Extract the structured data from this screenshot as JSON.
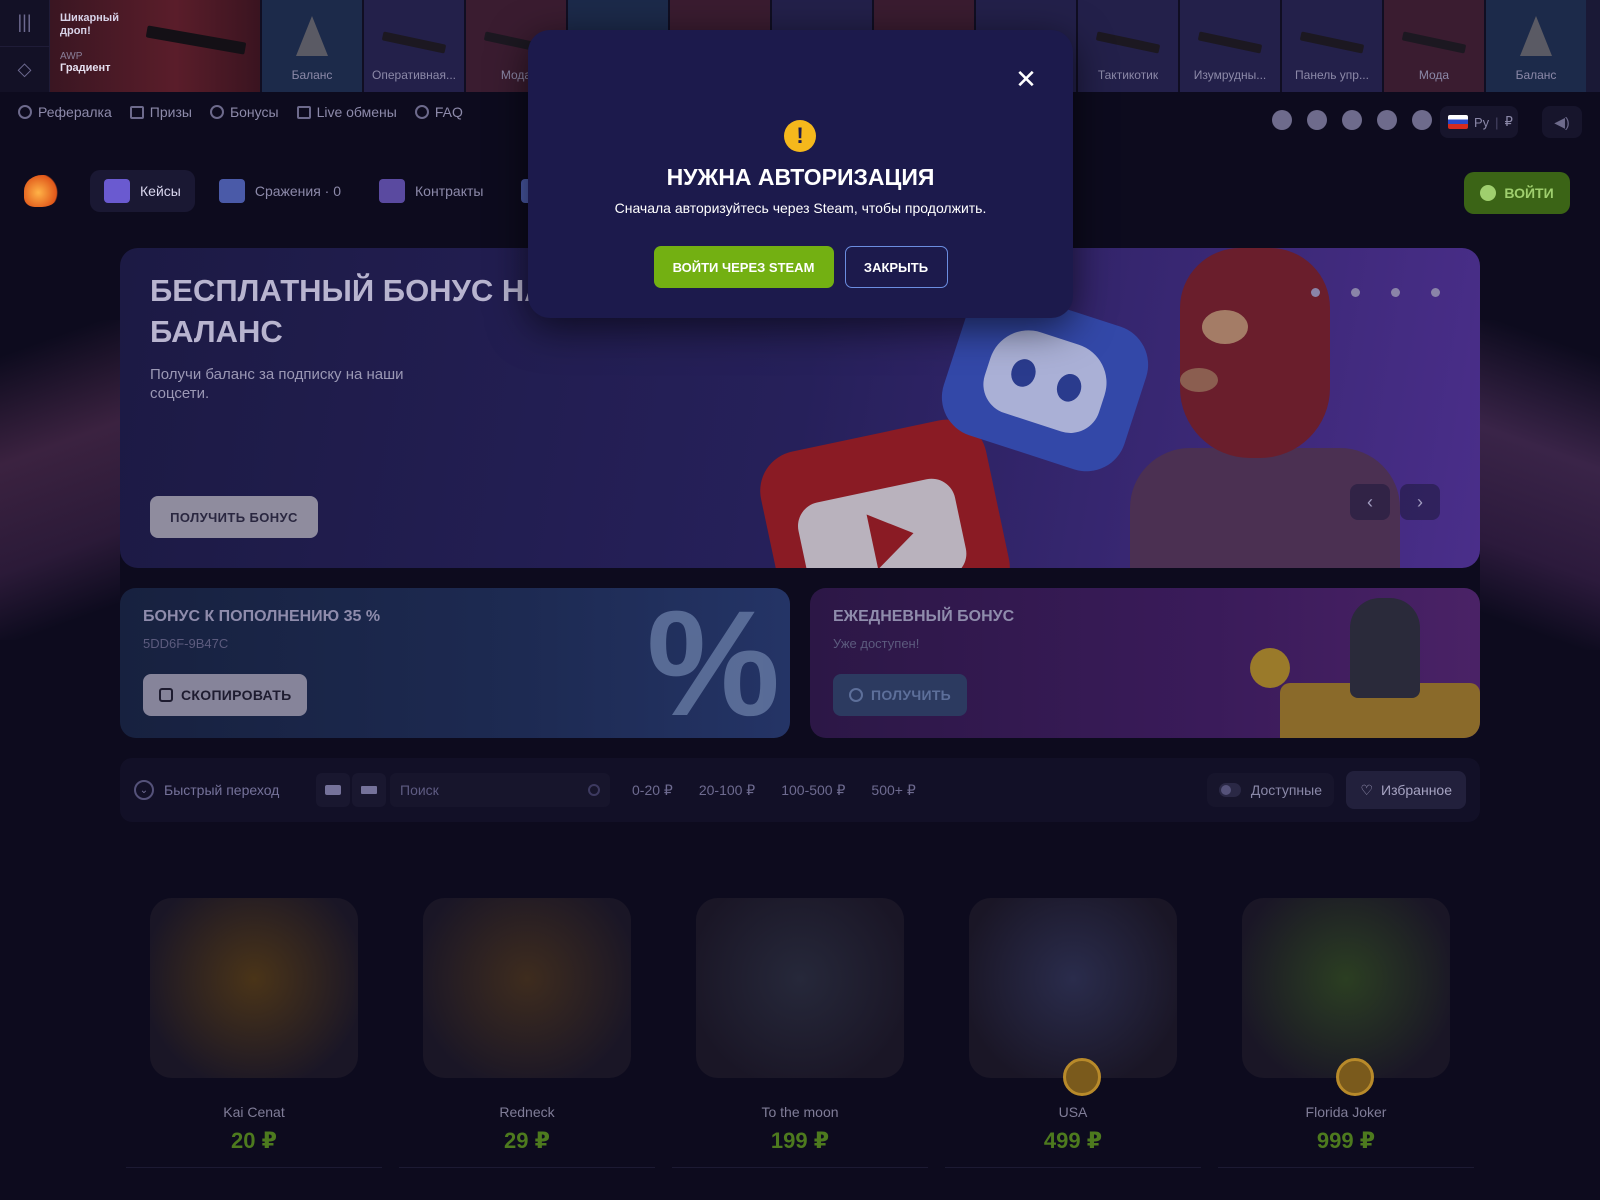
{
  "ticker": {
    "featured": {
      "label": "Шикарный дроп!",
      "weapon": "AWP",
      "skin": "Градиент"
    },
    "items": [
      {
        "label": "Баланс",
        "bg": "#1c2a4a",
        "kind": "tri"
      },
      {
        "label": "Оперативная...",
        "bg": "#23204a",
        "kind": "gun"
      },
      {
        "label": "Мода",
        "bg": "#3a1c30",
        "kind": "gun"
      },
      {
        "label": "",
        "bg": "#1c2a4a",
        "kind": "gun"
      },
      {
        "label": "",
        "bg": "#3a1c30",
        "kind": "gun"
      },
      {
        "label": "",
        "bg": "#23204a",
        "kind": "gun"
      },
      {
        "label": "",
        "bg": "#3a1c30",
        "kind": "gun"
      },
      {
        "label": "",
        "bg": "#23204a",
        "kind": "gun"
      },
      {
        "label": "Тактикотик",
        "bg": "#23204a",
        "kind": "gun"
      },
      {
        "label": "Изумрудны...",
        "bg": "#23204a",
        "kind": "gun"
      },
      {
        "label": "Панель упр...",
        "bg": "#23204a",
        "kind": "gun"
      },
      {
        "label": "Мода",
        "bg": "#3a1c30",
        "kind": "gun"
      },
      {
        "label": "Баланс",
        "bg": "#1c2a4a",
        "kind": "tri"
      }
    ]
  },
  "subnav": {
    "items": [
      {
        "label": "Рефералка",
        "icon": "medal-icon"
      },
      {
        "label": "Призы",
        "icon": "gift-icon"
      },
      {
        "label": "Бонусы",
        "icon": "coins-icon"
      },
      {
        "label": "Live обмены",
        "icon": "exchange-icon"
      },
      {
        "label": "FAQ",
        "icon": "question-icon"
      }
    ],
    "socials": [
      "discord-icon",
      "vk-icon",
      "telegram-icon",
      "youtube-icon",
      "tiktok-icon"
    ],
    "lang": "Ру",
    "currency": "₽"
  },
  "mainnav": {
    "items": [
      {
        "label": "Кейсы",
        "active": true,
        "color": "#6a5ad0"
      },
      {
        "label": "Сражения · 0",
        "active": false,
        "color": "#4a5aa8"
      },
      {
        "label": "Контракты",
        "active": false,
        "color": "#5a4aa0"
      },
      {
        "label": "",
        "active": false,
        "color": "#4a5aa8"
      }
    ],
    "login": "ВОЙТИ"
  },
  "hero": {
    "title": "БЕСПЛАТНЫЙ БОНУС НА БАЛАНС",
    "subtitle": "Получи баланс за подписку на наши соцсети.",
    "cta": "ПОЛУЧИТЬ БОНУС"
  },
  "cards": {
    "deposit": {
      "title": "БОНУС К ПОПОЛНЕНИЮ 35 %",
      "code": "5DD6F-9B47C",
      "button": "СКОПИРОВАТЬ"
    },
    "daily": {
      "title": "ЕЖЕДНЕВНЫЙ БОНУС",
      "status": "Уже доступен!",
      "button": "ПОЛУЧИТЬ"
    }
  },
  "filters": {
    "quick": "Быстрый переход",
    "search_placeholder": "Поиск",
    "ranges": [
      "0-20 ₽",
      "20-100 ₽",
      "100-500 ₽",
      "500+ ₽"
    ],
    "available": "Доступные",
    "favorites": "Избранное"
  },
  "cases": [
    {
      "name": "Kai Cenat",
      "price": "20 ₽",
      "bg": "#4a3418",
      "badge": false
    },
    {
      "name": "Redneck",
      "price": "29 ₽",
      "bg": "#3e2c1e",
      "badge": false
    },
    {
      "name": "To the moon",
      "price": "199 ₽",
      "bg": "#26283a",
      "badge": false
    },
    {
      "name": "USA",
      "price": "499 ₽",
      "bg": "#2a2c4c",
      "badge": true
    },
    {
      "name": "Florida Joker",
      "price": "999 ₽",
      "bg": "#2b3e22",
      "badge": true
    }
  ],
  "modal": {
    "title": "НУЖНА АВТОРИЗАЦИЯ",
    "message": "Сначала авторизуйтесь через Steam, чтобы продолжить.",
    "steam_button": "ВОЙТИ ЧЕРЕЗ STEAM",
    "close_button": "ЗАКРЫТЬ",
    "warning_glyph": "!"
  }
}
